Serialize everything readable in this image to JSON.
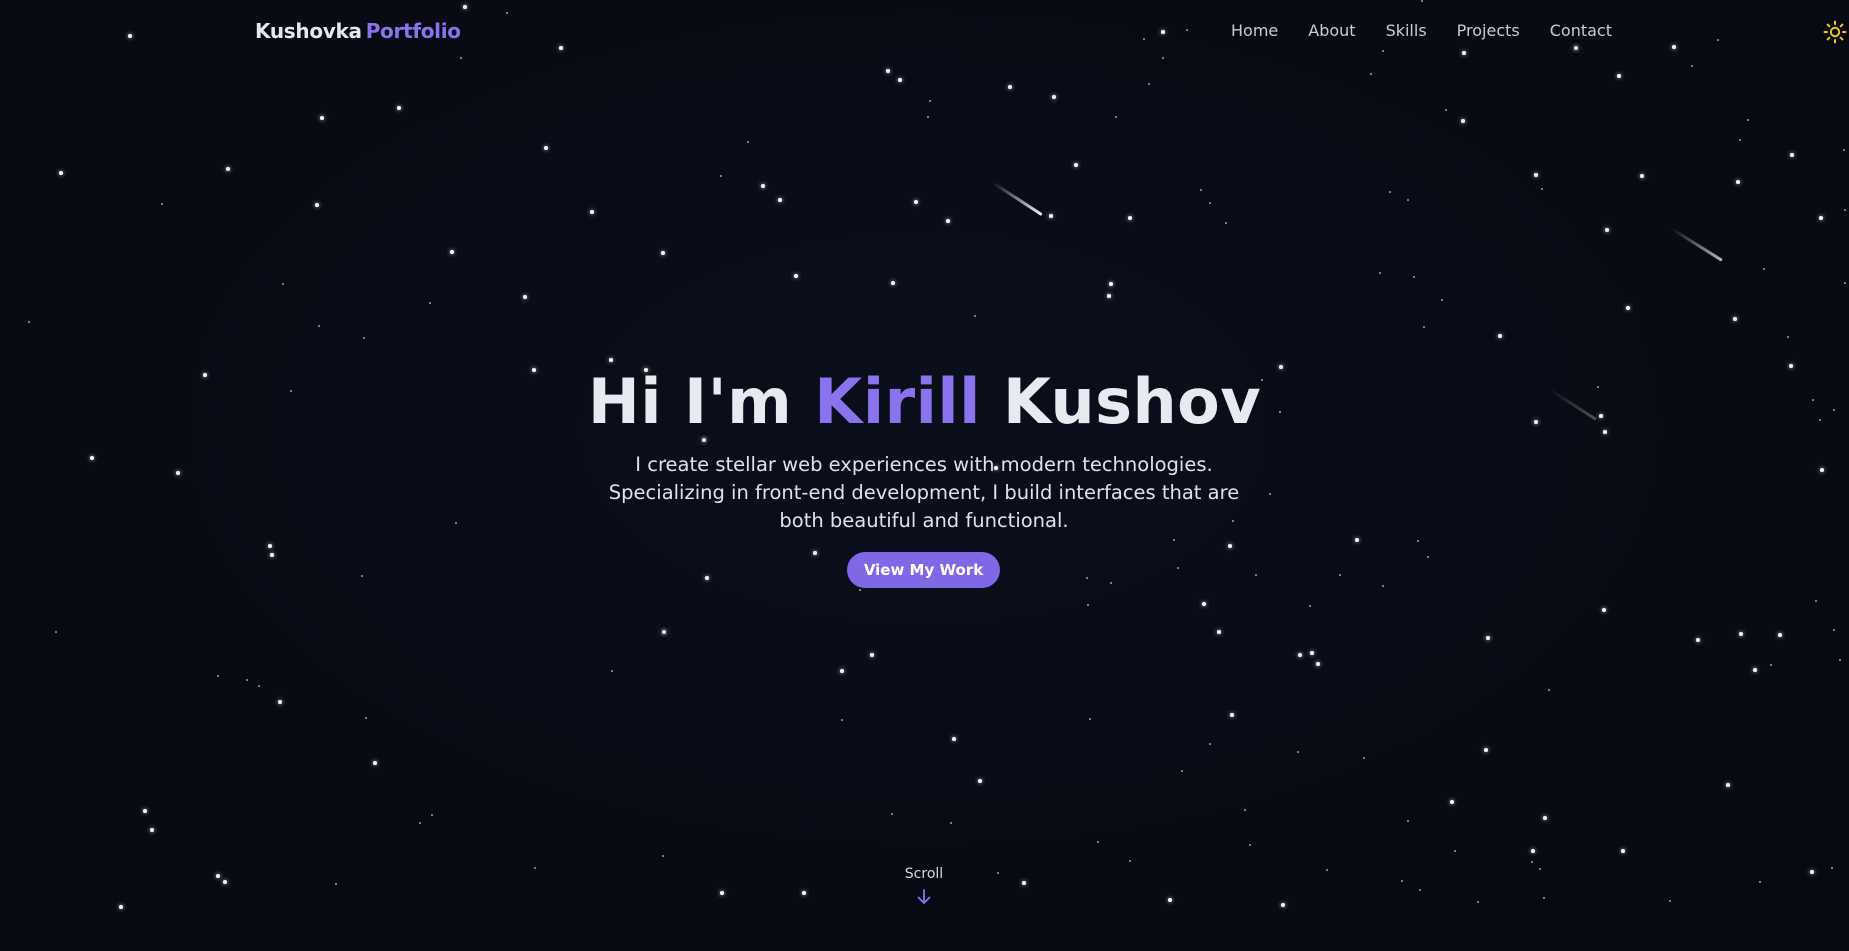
{
  "header": {
    "brand": {
      "main": "Kushovka",
      "accent": "Portfolio"
    },
    "nav": [
      {
        "label": "Home"
      },
      {
        "label": "About"
      },
      {
        "label": "Skills"
      },
      {
        "label": "Projects"
      },
      {
        "label": "Contact"
      }
    ],
    "theme_toggle_icon": "sun-icon"
  },
  "hero": {
    "title_prefix": "Hi I'm",
    "title_highlight": "Kirill",
    "title_suffix": "Kushov",
    "subtitle": "I create stellar web experiences with modern technologies. Specializing in front-end development, I build interfaces that are both beautiful and functional.",
    "cta_label": "View My Work"
  },
  "scroll": {
    "label": "Scroll",
    "icon": "arrow-down-icon"
  },
  "colors": {
    "background": "#080b14",
    "accent": "#8a73ec",
    "button": "#7f67e6",
    "text": "#e8eaf2",
    "sun": "#f5c518"
  }
}
